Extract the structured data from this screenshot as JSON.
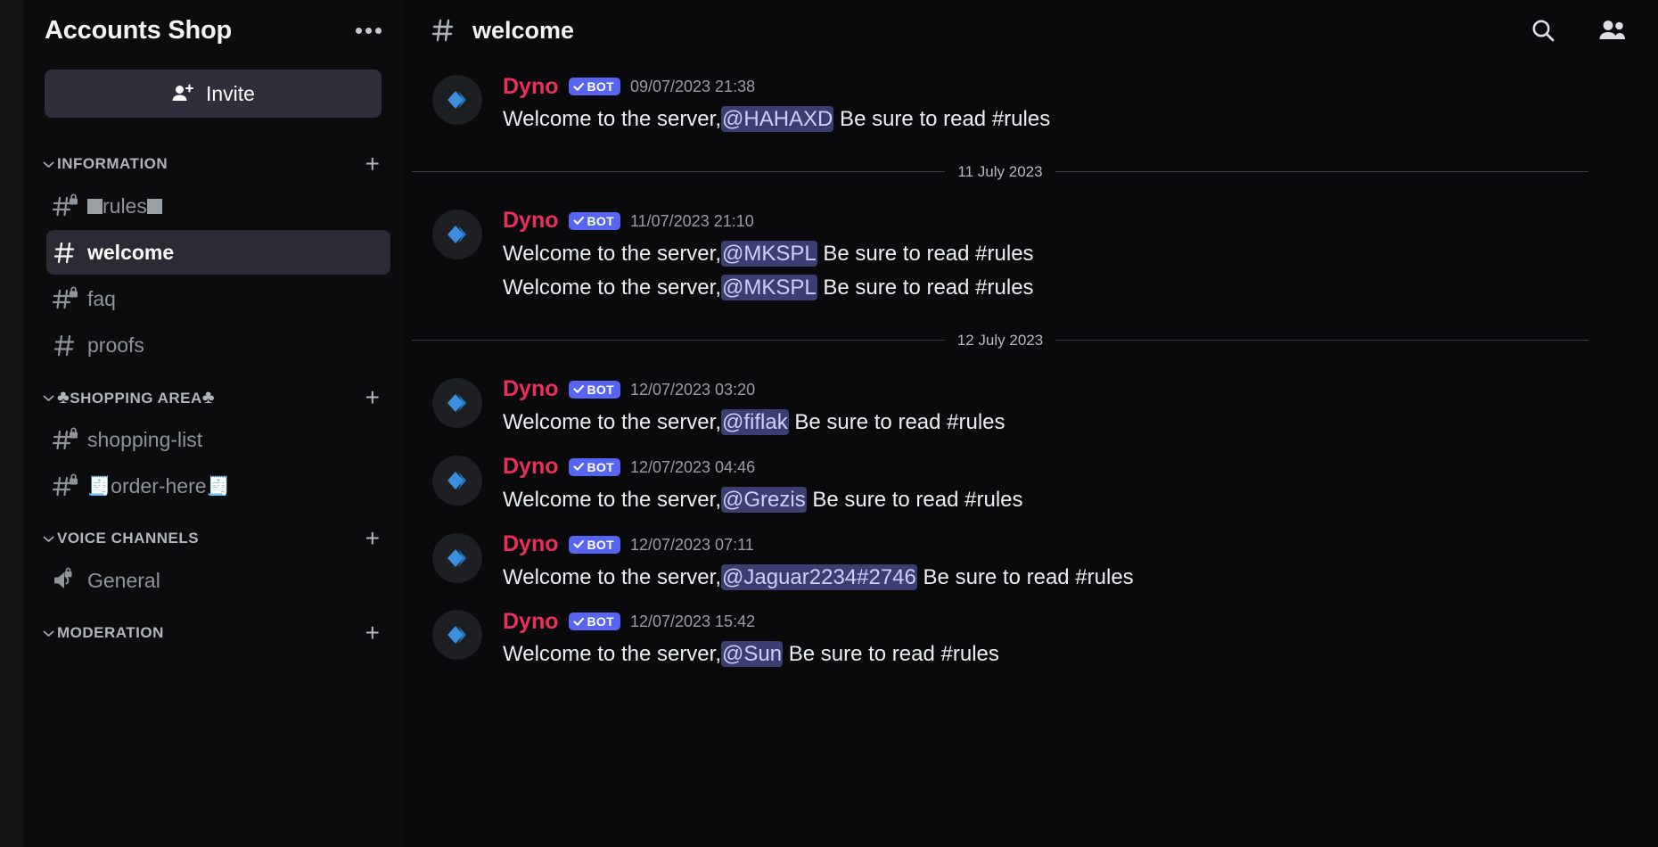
{
  "server": {
    "name": "Accounts Shop",
    "options_icon": "more-options-icon",
    "invite": {
      "label": "Invite",
      "icon": "person-add-icon"
    }
  },
  "sidebar": {
    "categories": [
      {
        "name": "INFORMATION",
        "collapse_icon": "chevron-down-icon",
        "add_icon": "plus-icon",
        "channels": [
          {
            "prefix": "",
            "name": "rules",
            "suffix": "",
            "left_emoji": "square-emoji",
            "right_emoji": "square-emoji",
            "locked": true,
            "active": false,
            "icon": "hash-locked-icon"
          },
          {
            "prefix": "",
            "name": "welcome",
            "suffix": "",
            "left_emoji": "",
            "right_emoji": "",
            "locked": false,
            "active": true,
            "icon": "hash-icon"
          },
          {
            "prefix": "",
            "name": "faq",
            "suffix": "",
            "left_emoji": "",
            "right_emoji": "",
            "locked": true,
            "active": false,
            "icon": "hash-locked-icon"
          },
          {
            "prefix": "",
            "name": "proofs",
            "suffix": "",
            "left_emoji": "",
            "right_emoji": "",
            "locked": false,
            "active": false,
            "icon": "hash-icon"
          }
        ]
      },
      {
        "name": "SHOPPING AREA",
        "name_left_emoji": "♣",
        "name_right_emoji": "♣",
        "collapse_icon": "chevron-down-icon",
        "add_icon": "plus-icon",
        "channels": [
          {
            "prefix": "",
            "name": "shopping-list",
            "suffix": "",
            "left_emoji": "",
            "right_emoji": "",
            "locked": true,
            "active": false,
            "icon": "hash-locked-icon"
          },
          {
            "prefix": "",
            "name": "order-here",
            "suffix": "",
            "left_emoji": "🧾",
            "right_emoji": "🧾",
            "locked": true,
            "active": false,
            "icon": "hash-locked-icon"
          }
        ]
      },
      {
        "name": "VOICE CHANNELS",
        "collapse_icon": "chevron-down-icon",
        "add_icon": "plus-icon",
        "channels": [
          {
            "prefix": "",
            "name": "General",
            "suffix": "",
            "left_emoji": "",
            "right_emoji": "",
            "locked": true,
            "active": false,
            "icon": "speaker-locked-icon"
          }
        ]
      },
      {
        "name": "MODERATION",
        "collapse_icon": "chevron-down-icon",
        "add_icon": "plus-icon",
        "channels": []
      }
    ]
  },
  "chat_header": {
    "hash_icon": "hash-icon",
    "channel_name": "welcome",
    "search_icon": "search-icon",
    "members_icon": "members-icon"
  },
  "messages": [
    {
      "type": "message",
      "author": "Dyno",
      "bot_label": "BOT",
      "timestamp": "09/07/2023 21:38",
      "avatar": "dyno-avatar",
      "lines": [
        {
          "before": "Welcome to the server,",
          "mention": "@HAHAXD",
          "after": " Be sure to read #rules"
        }
      ]
    },
    {
      "type": "divider",
      "text": "11 July 2023"
    },
    {
      "type": "message",
      "author": "Dyno",
      "bot_label": "BOT",
      "timestamp": "11/07/2023 21:10",
      "avatar": "dyno-avatar",
      "lines": [
        {
          "before": "Welcome to the server,",
          "mention": "@MKSPL",
          "after": " Be sure to read #rules"
        },
        {
          "before": "Welcome to the server,",
          "mention": "@MKSPL",
          "after": " Be sure to read #rules"
        }
      ]
    },
    {
      "type": "divider",
      "text": "12 July 2023"
    },
    {
      "type": "message",
      "author": "Dyno",
      "bot_label": "BOT",
      "timestamp": "12/07/2023 03:20",
      "avatar": "dyno-avatar",
      "lines": [
        {
          "before": "Welcome to the server,",
          "mention": "@fiflak",
          "after": " Be sure to read #rules"
        }
      ]
    },
    {
      "type": "message",
      "author": "Dyno",
      "bot_label": "BOT",
      "timestamp": "12/07/2023 04:46",
      "avatar": "dyno-avatar",
      "lines": [
        {
          "before": "Welcome to the server,",
          "mention": "@Grezis",
          "after": " Be sure to read #rules"
        }
      ]
    },
    {
      "type": "message",
      "author": "Dyno",
      "bot_label": "BOT",
      "timestamp": "12/07/2023 07:11",
      "avatar": "dyno-avatar",
      "lines": [
        {
          "before": "Welcome to the server,",
          "mention": "@Jaguar2234#2746",
          "after": " Be sure to read #rules"
        }
      ]
    },
    {
      "type": "message",
      "author": "Dyno",
      "bot_label": "BOT",
      "timestamp": "12/07/2023 15:42",
      "avatar": "dyno-avatar",
      "lines": [
        {
          "before": "Welcome to the server,",
          "mention": "@Sun",
          "after": " Be sure to read #rules"
        }
      ]
    }
  ],
  "colors": {
    "accent": "#5865f2",
    "author": "#eb2f5b",
    "mention_bg": "#3c3d70",
    "mention_fg": "#ccd0fb",
    "sidebar_bg": "#0c0c0f",
    "chat_bg": "#0a0a0c",
    "active_channel_bg": "#2a2b35"
  }
}
